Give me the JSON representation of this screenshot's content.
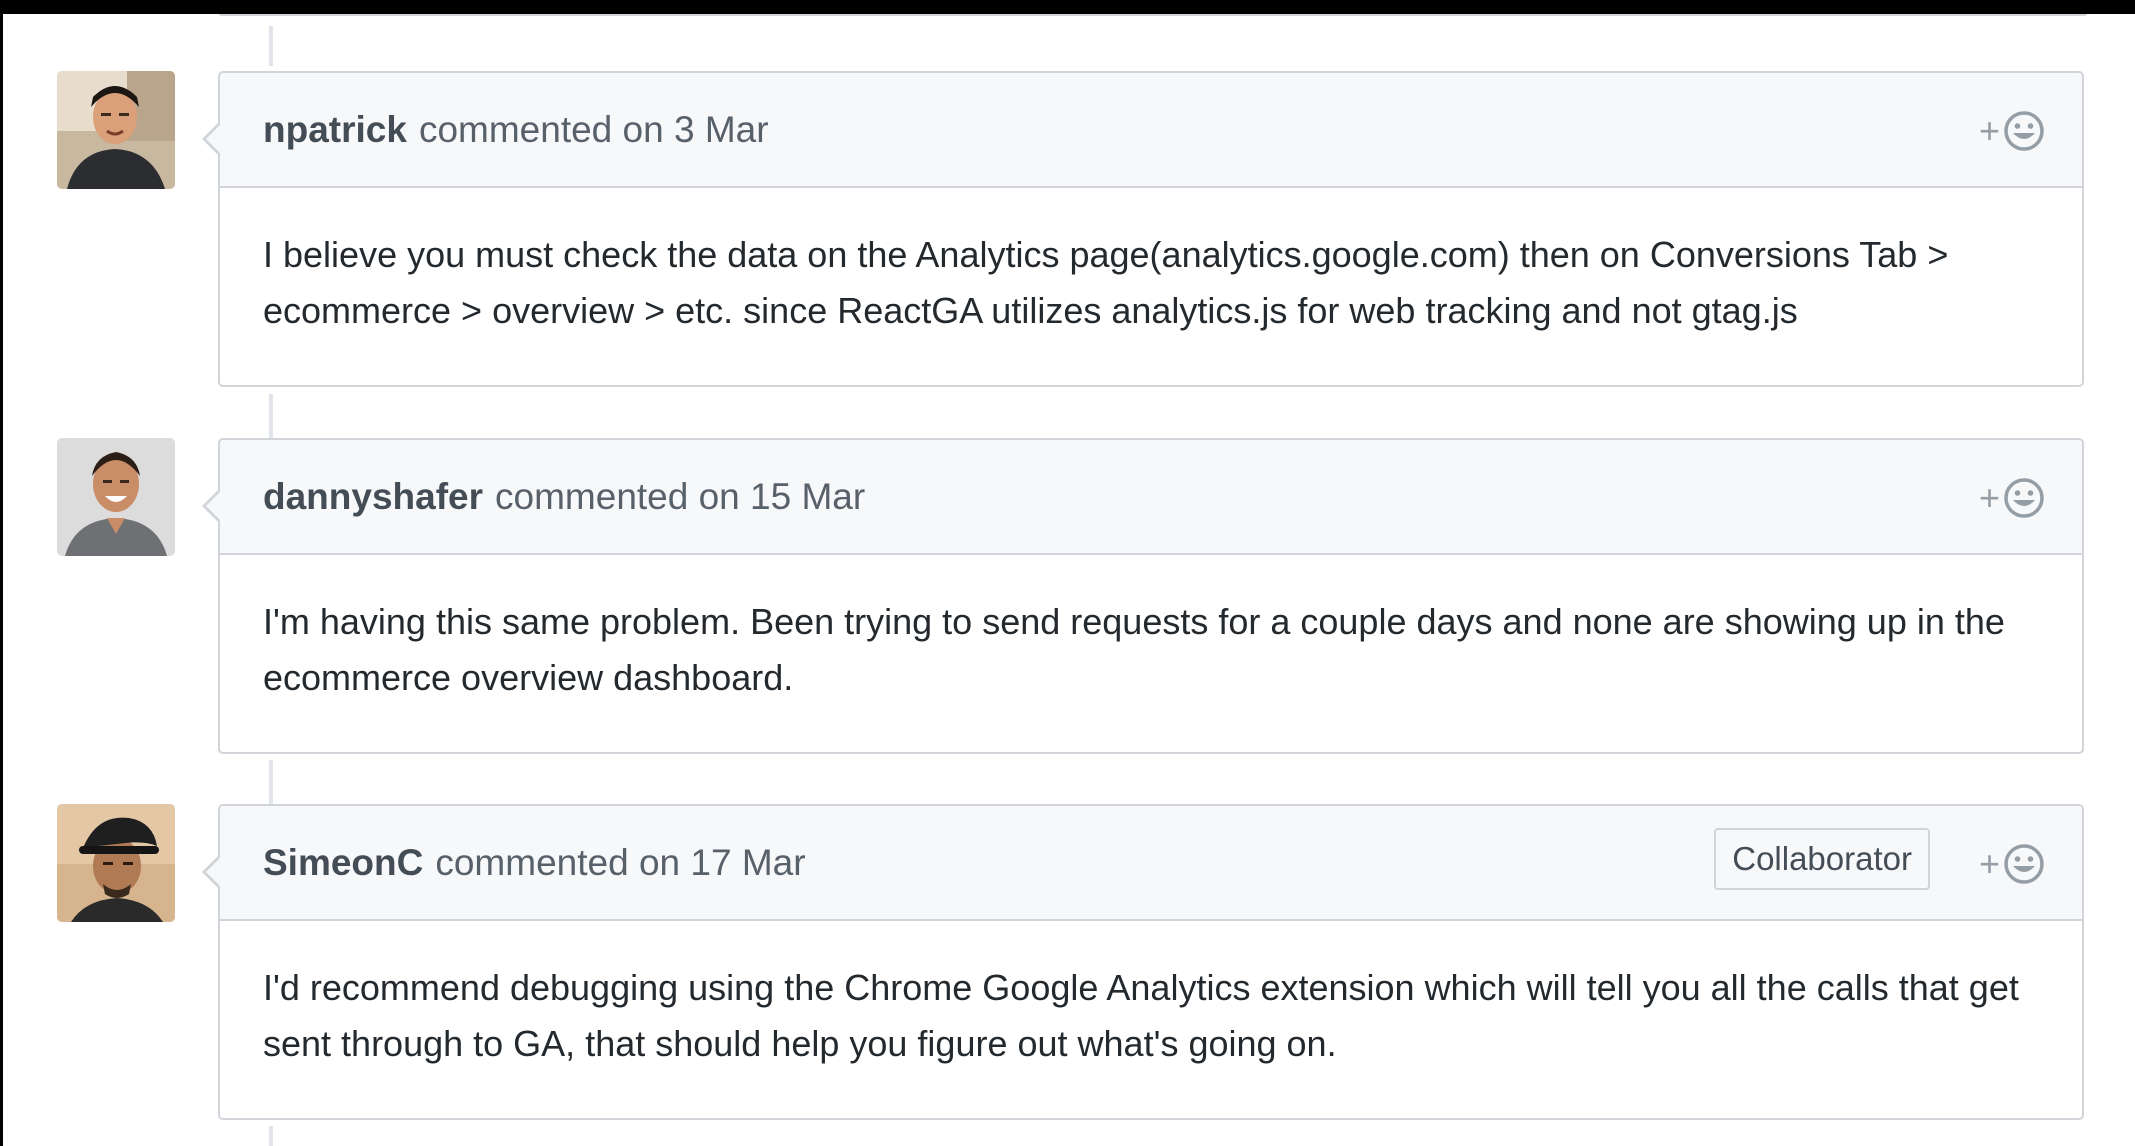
{
  "comments": [
    {
      "author": "npatrick",
      "meta": "commented on 3 Mar",
      "body": "I believe you must check the data on the Analytics page(analytics.google.com) then on Conversions Tab > ecommerce > overview > etc. since ReactGA utilizes analytics.js for web tracking and not gtag.js",
      "badge": null,
      "reaction_plus": "+"
    },
    {
      "author": "dannyshafer",
      "meta": "commented on 15 Mar",
      "body": "I'm having this same problem. Been trying to send requests for a couple days and none are showing up in the ecommerce overview dashboard.",
      "badge": null,
      "reaction_plus": "+"
    },
    {
      "author": "SimeonC",
      "meta": "commented on 17 Mar",
      "body": "I'd recommend debugging using the Chrome Google Analytics extension which will tell you all the calls that get sent through to GA, that should help you figure out what's going on.",
      "badge": "Collaborator",
      "reaction_plus": "+"
    }
  ],
  "colors": {
    "header_bg": "#f6f8fa",
    "border": "#d1d5da",
    "text": "#24292e",
    "muted": "#586069"
  },
  "icons": {
    "reaction": "smiley-icon"
  }
}
